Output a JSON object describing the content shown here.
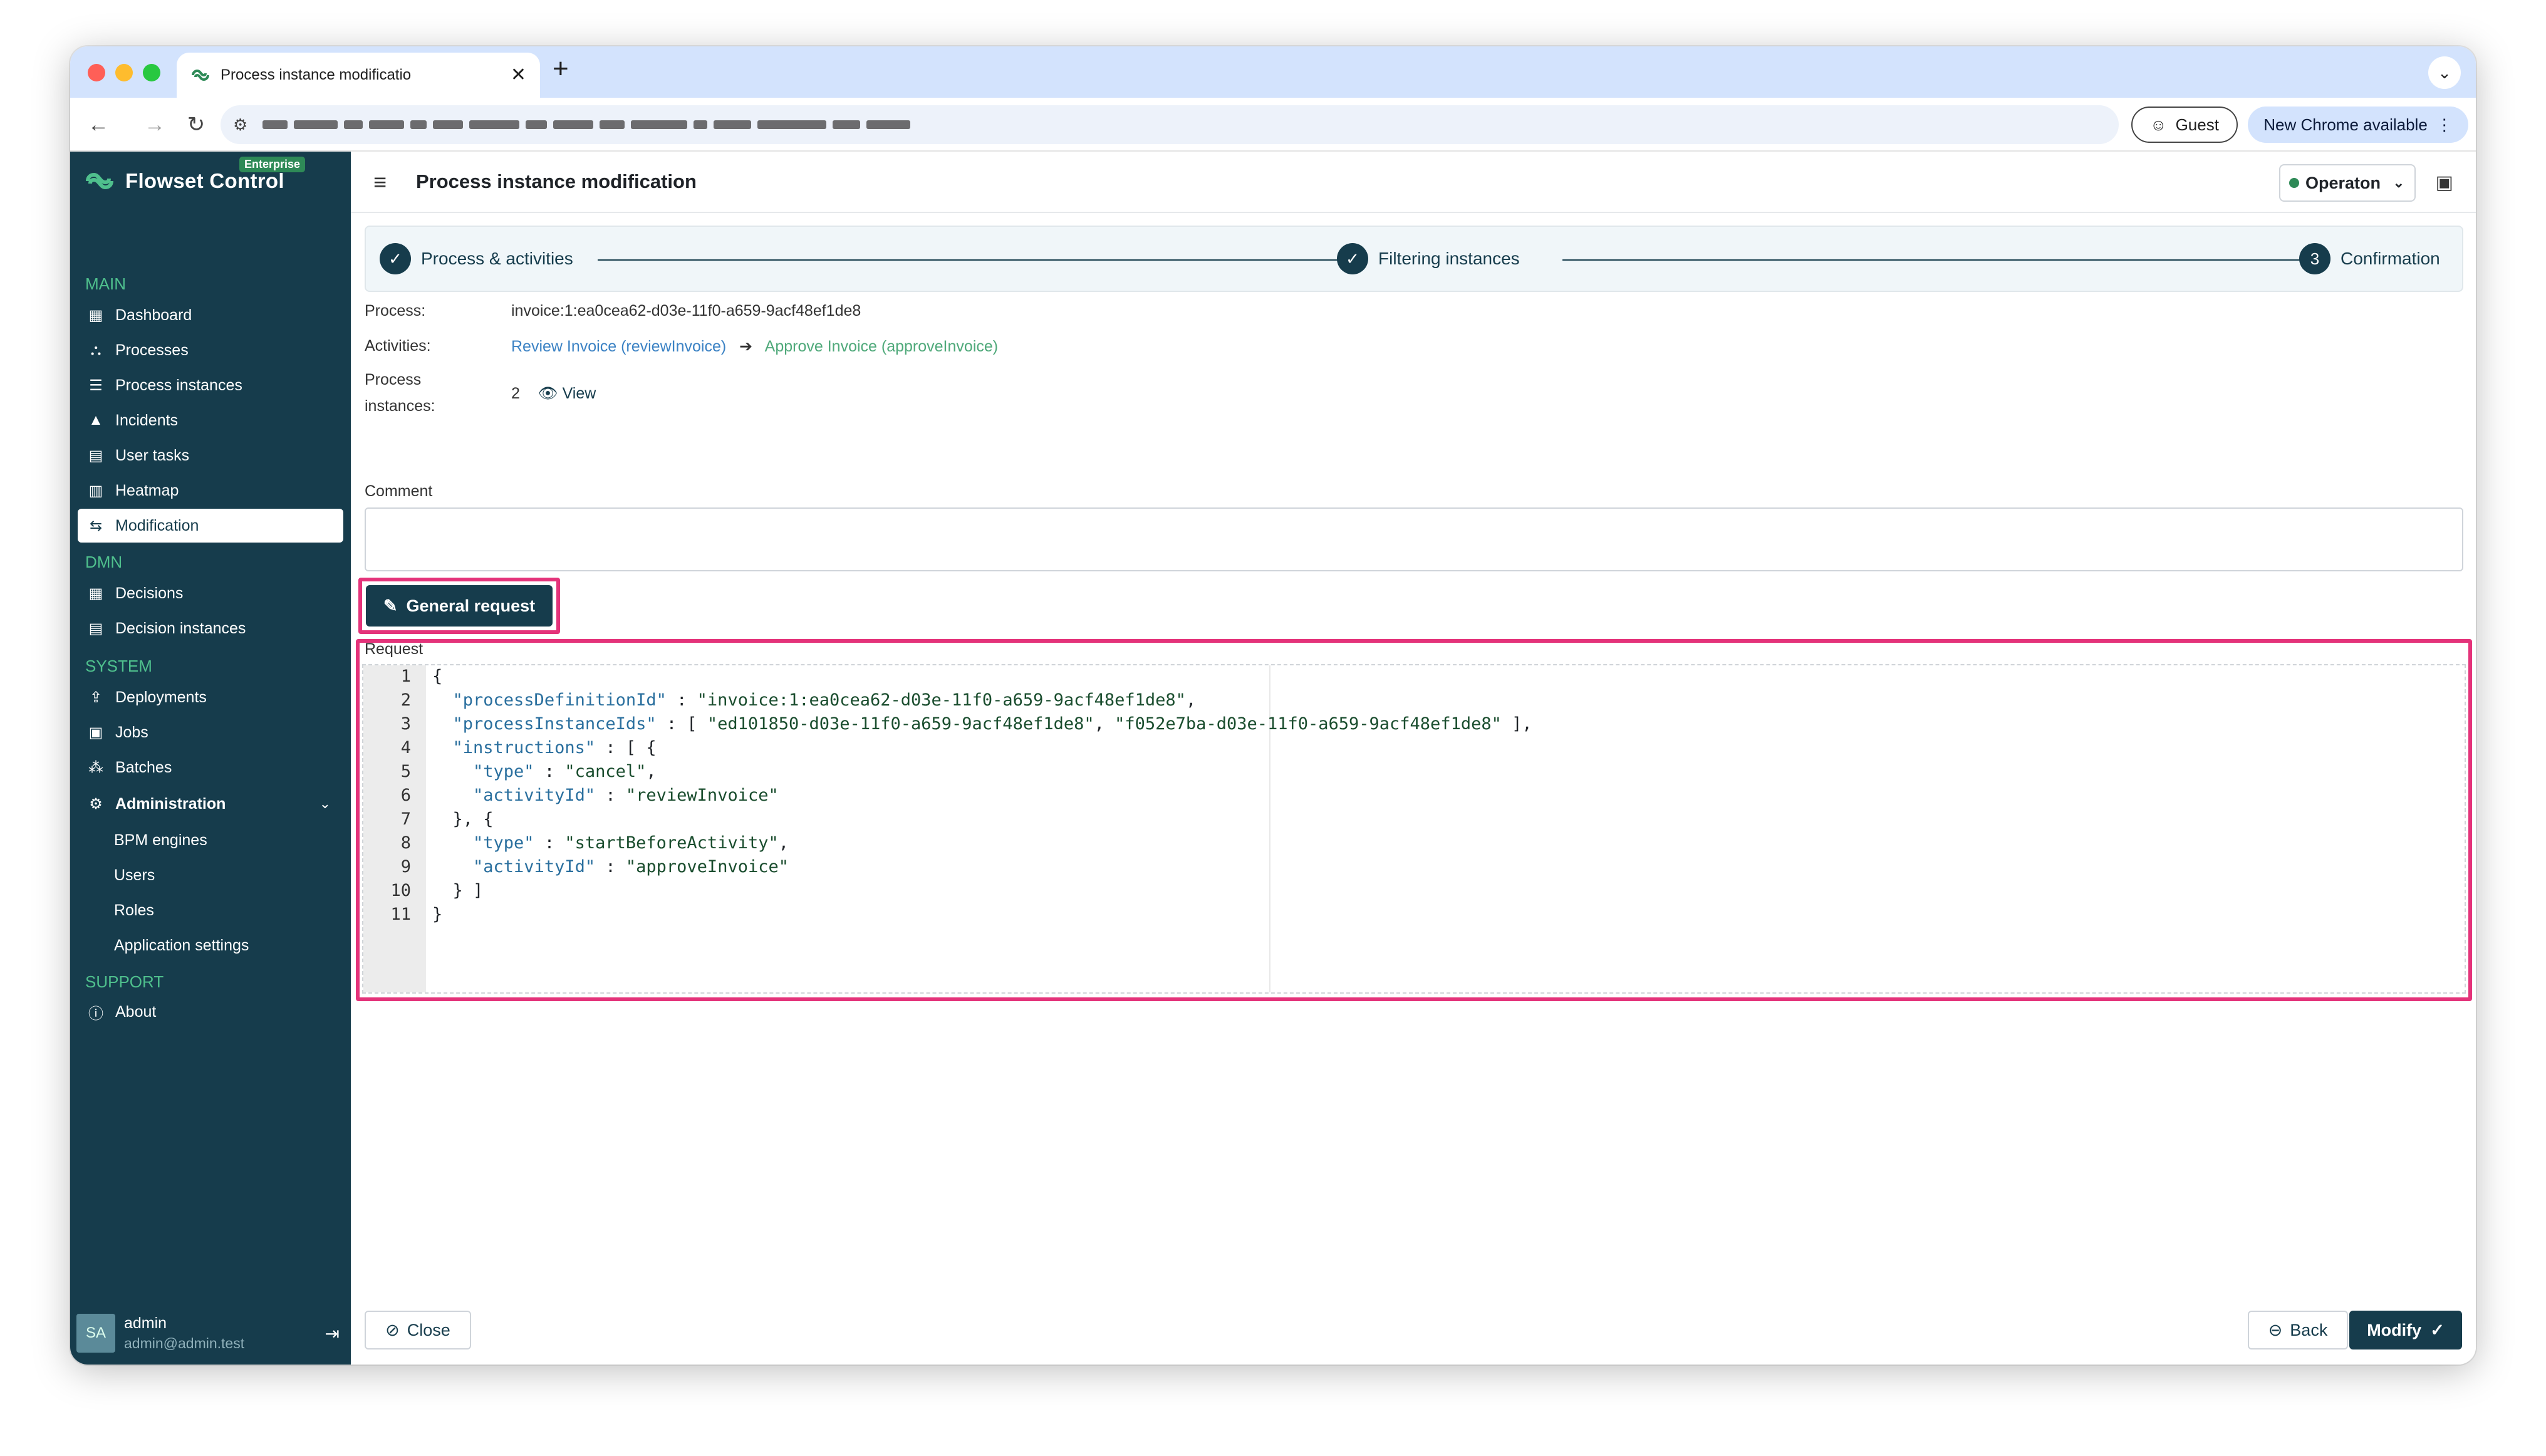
{
  "browser": {
    "tab_title": "Process instance modificatio",
    "new_tab_icon": "plus-icon",
    "guest_label": "Guest",
    "update_label": "New Chrome available"
  },
  "sidebar": {
    "logo_text": "Flowset Control",
    "badge": "Enterprise",
    "sections": {
      "main": "MAIN",
      "dmn": "DMN",
      "system": "SYSTEM",
      "support": "SUPPORT"
    },
    "items": {
      "dashboard": "Dashboard",
      "processes": "Processes",
      "process_instances": "Process instances",
      "incidents": "Incidents",
      "user_tasks": "User tasks",
      "heatmap": "Heatmap",
      "modification": "Modification",
      "decisions": "Decisions",
      "decision_instances": "Decision instances",
      "deployments": "Deployments",
      "jobs": "Jobs",
      "batches": "Batches",
      "administration": "Administration",
      "bpm_engines": "BPM engines",
      "users": "Users",
      "roles": "Roles",
      "application_settings": "Application settings",
      "about": "About"
    },
    "user": {
      "initials": "SA",
      "name": "admin",
      "email": "admin@admin.test"
    }
  },
  "header": {
    "title": "Process instance modification",
    "engine": "Operaton"
  },
  "stepper": {
    "step1": "Process & activities",
    "step2": "Filtering instances",
    "step3": "Confirmation",
    "step3_number": "3"
  },
  "info": {
    "process_label": "Process:",
    "process_value": "invoice:1:ea0cea62-d03e-11f0-a659-9acf48ef1de8",
    "activities_label": "Activities:",
    "activity_from": "Review Invoice (reviewInvoice)",
    "activity_to": "Approve Invoice (approveInvoice)",
    "instances_label_1": "Process",
    "instances_label_2": "instances:",
    "instances_count": "2",
    "view_label": "View"
  },
  "comment": {
    "label": "Comment",
    "value": ""
  },
  "general_request_label": "General request",
  "request": {
    "label": "Request",
    "line_numbers": [
      "1",
      "2",
      "3",
      "4",
      "5",
      "6",
      "7",
      "8",
      "9",
      "10",
      "11"
    ]
  },
  "footer": {
    "close_label": "Close",
    "back_label": "Back",
    "modify_label": "Modify"
  },
  "colors": {
    "sidebar_bg": "#163c4c",
    "accent_green": "#4fc08d",
    "highlight": "#e4337a"
  }
}
